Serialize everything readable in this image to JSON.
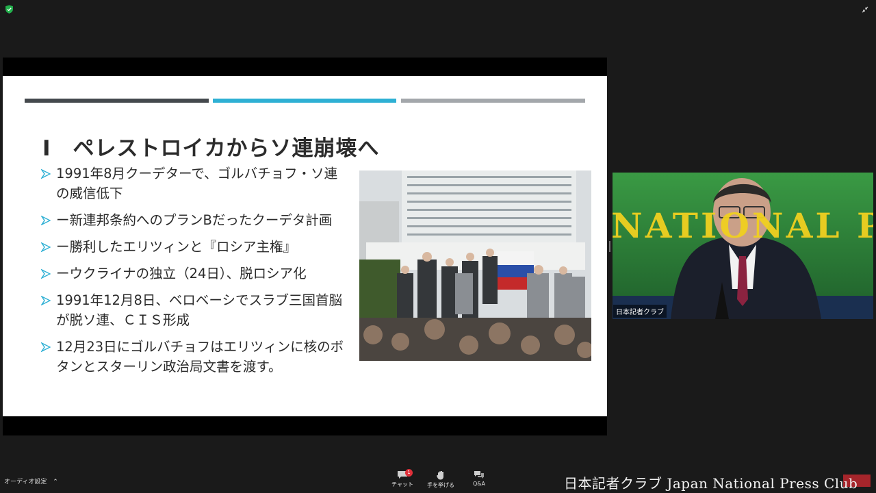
{
  "slide": {
    "title": "Ⅰ　ペレストロイカからソ連崩壊へ",
    "bullets": [
      "1991年8月クーデターで、ゴルバチョフ・ソ連の威信低下",
      "ー新連邦条約へのプランBだったクーデタ計画",
      "ー勝利したエリツィンと『ロシア主権』",
      "ーウクライナの独立（24日）、脱ロシア化",
      "1991年12月8日、ベロベーシでスラブ三国首脳が脱ソ連、ＣＩＳ形成",
      "12月23日にゴルバチョフはエリツィンに核のボタンとスターリン政治局文書を渡す。"
    ],
    "colors": {
      "bar_dark": "#44494d",
      "bar_accent": "#2eb0d4",
      "bar_light": "#a3a7ab",
      "bullet_arrow": "#2eb0d4"
    }
  },
  "video": {
    "participant_name": "日本記者クラブ",
    "backdrop_text": "NATIONAL PR"
  },
  "toolbar": {
    "audio_label": "オーディオ設定",
    "chat_label": "チャット",
    "chat_badge": "1",
    "raise_hand_label": "手を挙げる",
    "qa_label": "Q&A"
  },
  "watermark": {
    "text": "日本記者クラブ Japan National Press Club"
  },
  "icons": [
    "shield-icon",
    "collapse-icon",
    "chevron-up-icon",
    "chat-icon",
    "hand-icon",
    "qa-icon",
    "bullet-arrow-icon"
  ]
}
